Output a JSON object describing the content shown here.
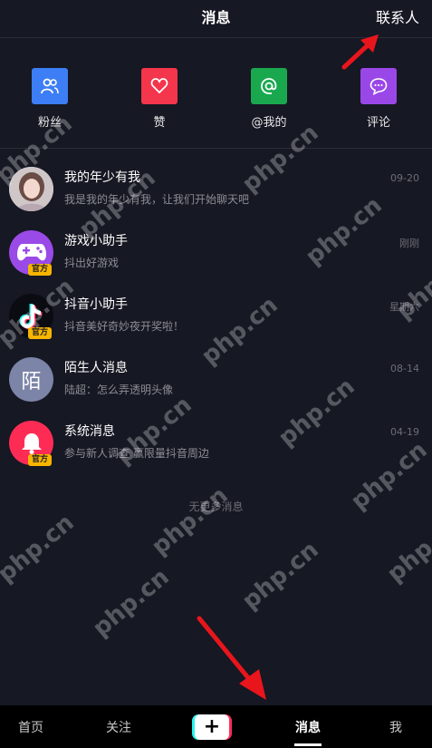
{
  "header": {
    "title": "消息",
    "contacts_label": "联系人"
  },
  "shortcuts": [
    {
      "label": "粉丝",
      "icon": "fans-icon",
      "color": "#3d7ef6"
    },
    {
      "label": "赞",
      "icon": "heart-icon",
      "color": "#f4364c"
    },
    {
      "label": "@我的",
      "icon": "at-icon",
      "color": "#1aa84f"
    },
    {
      "label": "评论",
      "icon": "comment-icon",
      "color": "#9a47e8"
    }
  ],
  "messages": [
    {
      "title": "我的年少有我",
      "preview": "我是我的年少有我，让我们开始聊天吧",
      "time": "09-20",
      "official": ""
    },
    {
      "title": "游戏小助手",
      "preview": "抖出好游戏",
      "time": "刚刚",
      "official": "官方"
    },
    {
      "title": "抖音小助手",
      "preview": "抖音美好奇妙夜开奖啦！",
      "time": "星期六",
      "official": "官方"
    },
    {
      "title": "陌生人消息",
      "preview": "陆超：怎么弄透明头像",
      "time": "08-14",
      "official": "",
      "avatar_char": "陌"
    },
    {
      "title": "系统消息",
      "preview": "参与新人调查 赢限量抖音周边",
      "time": "04-19",
      "official": "官方"
    }
  ],
  "no_more": "无更多消息",
  "watermark": "php.cn",
  "bottom_nav": {
    "home": "首页",
    "follow": "关注",
    "plus": "+",
    "messages": "消息",
    "me": "我"
  },
  "colors": {
    "background": "#161823",
    "accent_red": "#fe2c55",
    "accent_cyan": "#25f4ee",
    "arrow_red": "#e8161c"
  }
}
